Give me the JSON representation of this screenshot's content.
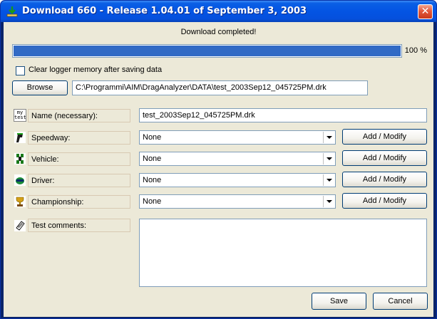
{
  "window": {
    "title": "Download 660  -  Release 1.04.01 of September 3, 2003",
    "close_glyph": "✕"
  },
  "status": "Download completed!",
  "progress": {
    "fraction": 1.0,
    "percent_label": "100 %"
  },
  "clear_memory": {
    "label": "Clear logger memory after saving data",
    "checked": false
  },
  "browse": {
    "label": "Browse",
    "path": "C:\\Programmi\\AIM\\DragAnalyzer\\DATA\\test_2003Sep12_045725PM.drk"
  },
  "name": {
    "label": "Name (necessary):",
    "value": "test_2003Sep12_045725PM.drk",
    "icon_text": "my\ntest"
  },
  "rows": [
    {
      "label": "Speedway:",
      "value": "None",
      "button": "Add / Modify",
      "icon": "speedway-icon"
    },
    {
      "label": "Vehicle:",
      "value": "None",
      "button": "Add / Modify",
      "icon": "vehicle-icon"
    },
    {
      "label": "Driver:",
      "value": "None",
      "button": "Add / Modify",
      "icon": "driver-icon"
    },
    {
      "label": "Championship:",
      "value": "None",
      "button": "Add / Modify",
      "icon": "trophy-icon"
    }
  ],
  "comments": {
    "label": "Test comments:",
    "value": ""
  },
  "actions": {
    "save": "Save",
    "cancel": "Cancel"
  },
  "colors": {
    "progress": "#316ac5",
    "titlebar": "#0454e3",
    "client": "#ece9d8"
  }
}
